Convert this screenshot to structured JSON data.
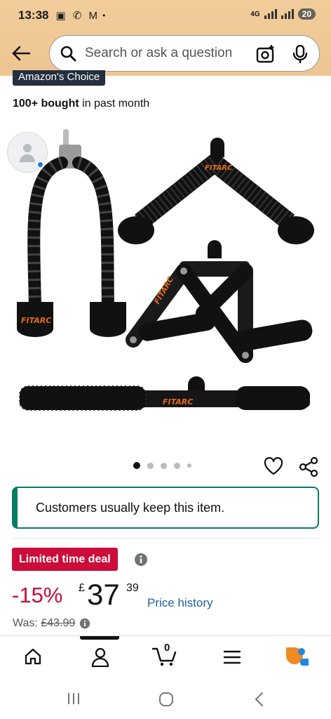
{
  "status_bar": {
    "time": "13:38",
    "notif_icons": "▣ ✆ M",
    "dot": "•",
    "network": "4G",
    "battery": "20"
  },
  "search": {
    "placeholder": "Search or ask a question"
  },
  "product": {
    "badge": "Amazon's Choice",
    "bought_bold": "100+ bought",
    "bought_rest": " in past month",
    "image_brand": "FITARC",
    "gallery_dots": 5,
    "gallery_active": 0
  },
  "banner": {
    "text": "Customers usually keep this item."
  },
  "pricing": {
    "deal_badge": "Limited time deal",
    "discount": "-15%",
    "currency": "£",
    "whole": "37",
    "fraction": "39",
    "price_history": "Price history",
    "was_label": "Was:",
    "was_price": "£43.99"
  },
  "bottom_nav": {
    "cart_count": "0",
    "items": [
      "home-icon",
      "account-icon",
      "cart-icon",
      "menu-icon",
      "rufus-icon"
    ]
  },
  "colors": {
    "header": "#eec592",
    "deal_red": "#cc0c39",
    "keep_green": "#067d62",
    "link_blue": "#2162a1"
  }
}
